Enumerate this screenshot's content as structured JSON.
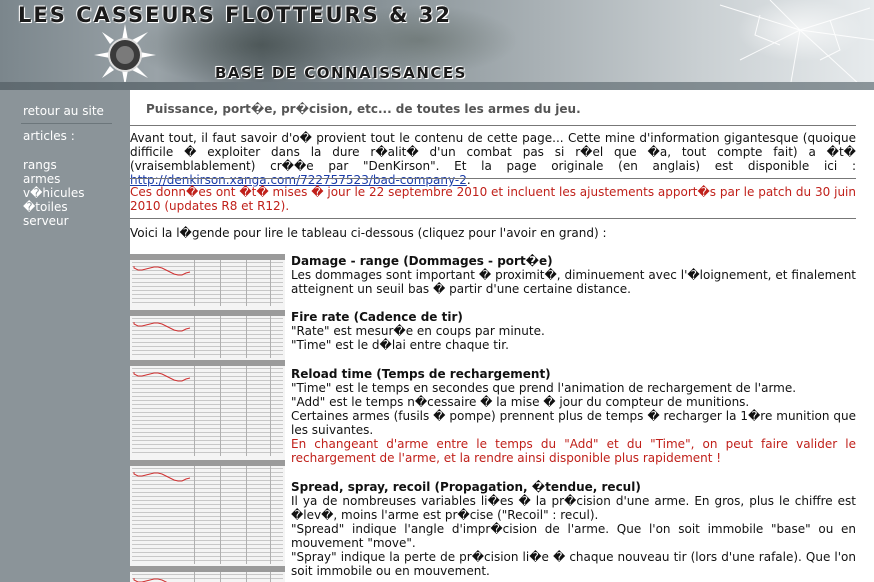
{
  "site": {
    "title": "LES CASSEURS FLOTTEURS & 32",
    "subtitle": "BASE DE CONNAISSANCES"
  },
  "sidebar": {
    "back": "retour au site",
    "articles": "articles :",
    "items": [
      "rangs",
      "armes",
      "v�hicules",
      "�toiles",
      "serveur"
    ]
  },
  "page": {
    "heading": "Puissance, port�e, pr�cision, etc... de toutes les armes du jeu.",
    "intro": "Avant tout, il faut savoir d'o� provient tout le contenu de cette page... Cette mine d'information gigantesque (quoique difficile � exploiter dans la dure r�alit� d'un combat pas si r�el que �a, tout compte fait) a �t� (vraisemblablement) cr��e par \"DenKirson\". Et la page originale (en anglais) est disponible ici : ",
    "intro_link": "http://denkirson.xanga.com/722757523/bad-company-2",
    "intro_end": ".",
    "update_note": "Ces donn�es ont �t� mises � jour le 22 septembre 2010 et incluent les ajustements apport�s par le patch du 30 juin 2010 (updates R8 et R12).",
    "legend_intro": "Voici la l�gende pour lire le tableau ci-dessous (cliquez pour l'avoir en grand) :",
    "sections": [
      {
        "title": "Damage - range (Dommages - port�e)",
        "lines": [
          "Les dommages sont important � proximit�, diminuement avec l'�loignement, et finalement atteignent un seuil bas � partir d'une certaine distance."
        ]
      },
      {
        "title": "Fire rate (Cadence de tir)",
        "lines": [
          "\"Rate\" est mesur�e en coups par minute.",
          "\"Time\" est le d�lai entre chaque tir."
        ]
      },
      {
        "title": "Reload time (Temps de rechargement)",
        "lines": [
          "\"Time\" est le temps en secondes que prend l'animation de rechargement de l'arme.",
          "\"Add\" est le temps n�cessaire � la mise � jour du compteur de munitions.",
          "Certaines armes (fusils � pompe) prennent plus de temps � recharger la 1�re munition que les suivantes."
        ],
        "red": "En changeant d'arme entre le temps du \"Add\" et du \"Time\", on peut faire valider le rechargement de l'arme, et la rendre ainsi disponible plus rapidement !"
      },
      {
        "title": "Spread, spray, recoil (Propagation, �tendue, recul)",
        "lines": [
          "Il ya de nombreuses variables li�es � la pr�cision d'une arme. En gros, plus le chiffre est �lev�, moins l'arme est pr�cise (\"Recoil\" : recul).",
          "\"Spread\" indique l'angle d'impr�cision de l'arme. Que l'on soit immobile \"base\" ou en mouvement \"move\".",
          "\"Spray\" indique la perte de pr�cision li�e � chaque nouveau tir (lors d'une rafale). Que l'on soit immobile ou en mouvement."
        ]
      }
    ]
  },
  "colors": {
    "sidebar_bg": "#8b9499",
    "text_red": "#c0201a",
    "link": "#1a3ca8"
  }
}
